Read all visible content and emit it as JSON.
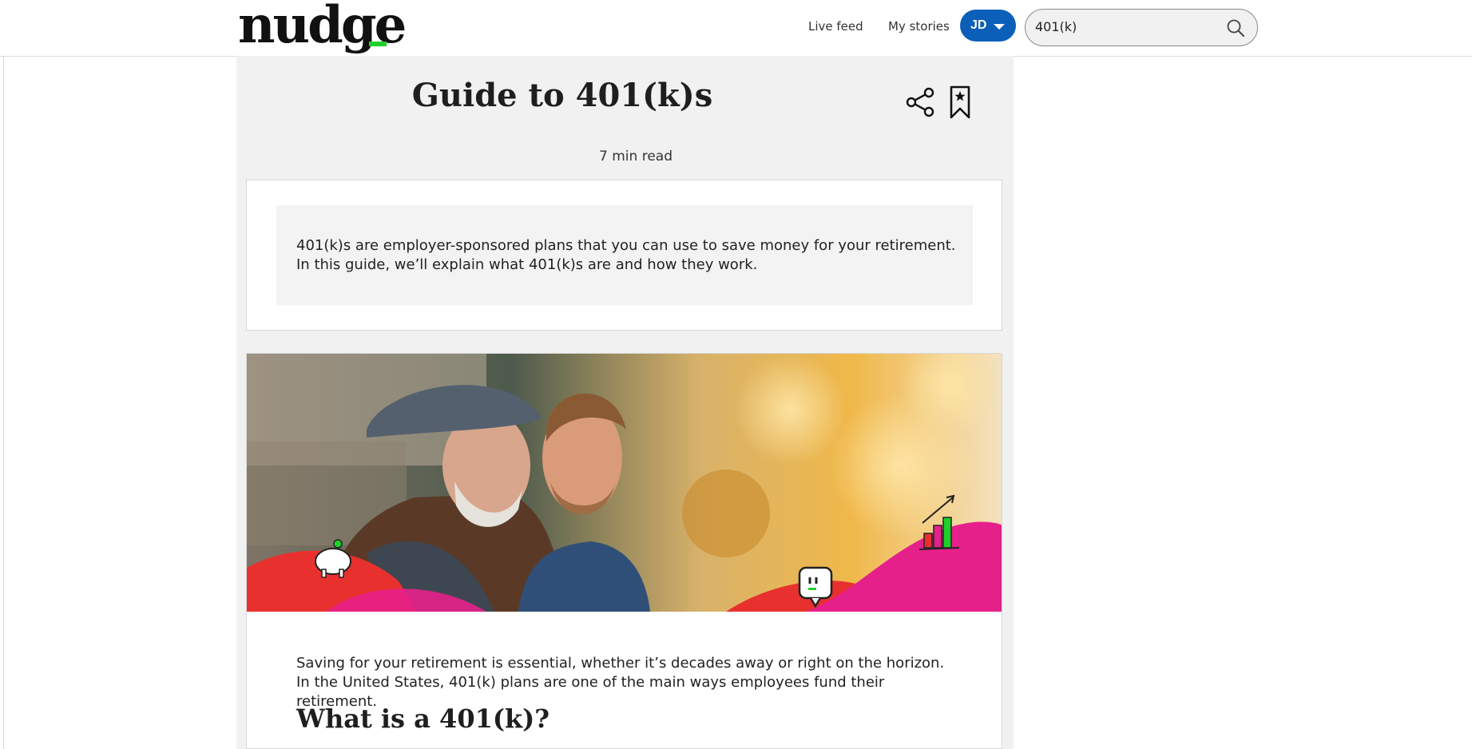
{
  "header": {
    "logo_text": "nudge",
    "nav": {
      "live_feed": "Live feed",
      "my_stories": "My stories"
    },
    "user": {
      "initials": "JD"
    },
    "search": {
      "value": "401(k)"
    }
  },
  "article": {
    "title": "Guide to 401(k)s",
    "read_time": "7 min read",
    "summary": "401(k)s are employer-sponsored plans that you can use to save money for your retirement. In this guide, we’ll explain what 401(k)s are and how they work.",
    "intro": "Saving for your retirement is essential, whether it’s decades away or right on the horizon. In the United States, 401(k) plans are one of the main ways employees fund their retirement.",
    "section_heading": "What is a 401(k)?"
  },
  "colors": {
    "brand_green": "#1ed12a",
    "accent_blue": "#0b5fb8",
    "hero_pink": "#e6208a",
    "hero_red": "#e8312f"
  }
}
